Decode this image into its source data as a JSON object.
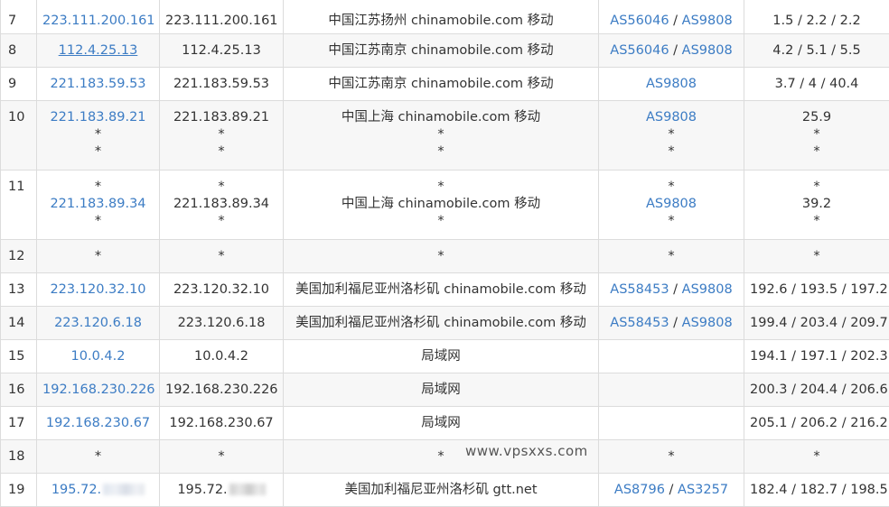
{
  "rows": [
    {
      "hop": "7",
      "ip": "223.111.200.161",
      "host": "223.111.200.161",
      "loc": "中国江苏扬州 chinamobile.com 移动",
      "as1": "AS56046",
      "as2": "AS9808",
      "time": "1.5 / 2.2 / 2.2"
    },
    {
      "hop": "8",
      "ip": "112.4.25.13",
      "host": "112.4.25.13",
      "loc": "中国江苏南京 chinamobile.com 移动",
      "as1": "AS56046",
      "as2": "AS9808",
      "time": "4.2 / 5.1 / 5.5"
    },
    {
      "hop": "9",
      "ip": "221.183.59.53",
      "host": "221.183.59.53",
      "loc": "中国江苏南京 chinamobile.com 移动",
      "as1": "AS9808",
      "time": "3.7 / 4 / 40.4"
    },
    {
      "hop": "10",
      "ip": "221.183.89.21",
      "host": "221.183.89.21",
      "loc": "中国上海 chinamobile.com 移动",
      "as1": "AS9808",
      "time": "25.9",
      "star": "*"
    },
    {
      "hop": "11",
      "ip": "221.183.89.34",
      "host": "221.183.89.34",
      "loc": "中国上海 chinamobile.com 移动",
      "as1": "AS9808",
      "time": "39.2",
      "star": "*"
    },
    {
      "hop": "12",
      "star": "*"
    },
    {
      "hop": "13",
      "ip": "223.120.32.10",
      "host": "223.120.32.10",
      "loc": "美国加利福尼亚州洛杉矶 chinamobile.com 移动",
      "as1": "AS58453",
      "as2": "AS9808",
      "time": "192.6 / 193.5 / 197.2"
    },
    {
      "hop": "14",
      "ip": "223.120.6.18",
      "host": "223.120.6.18",
      "loc": "美国加利福尼亚州洛杉矶 chinamobile.com 移动",
      "as1": "AS58453",
      "as2": "AS9808",
      "time": "199.4 / 203.4 / 209.7"
    },
    {
      "hop": "15",
      "ip": "10.0.4.2",
      "host": "10.0.4.2",
      "loc": "局域网",
      "time": "194.1 / 197.1 / 202.3"
    },
    {
      "hop": "16",
      "ip": "192.168.230.226",
      "host": "192.168.230.226",
      "loc": "局域网",
      "time": "200.3 / 204.4 / 206.6"
    },
    {
      "hop": "17",
      "ip": "192.168.230.67",
      "host": "192.168.230.67",
      "loc": "局域网",
      "time": "205.1 / 206.2 / 216.2"
    },
    {
      "hop": "18",
      "star": "*"
    },
    {
      "hop": "19",
      "ip": "195.72.",
      "host": "195.72.",
      "loc": "美国加利福尼亚州洛杉矶 gtt.net",
      "as1": "AS8796",
      "as2": "AS3257",
      "time": "182.4 / 182.7 / 198.5"
    }
  ],
  "as_separator": " / ",
  "watermark": "www.vpsxxs.com"
}
